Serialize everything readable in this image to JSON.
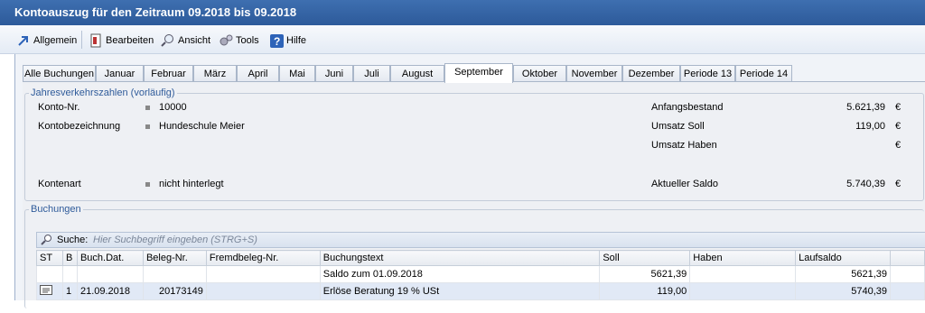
{
  "window": {
    "title": "Kontoauszug für den Zeitraum 09.2018 bis 09.2018"
  },
  "menu": [
    {
      "label": "Allgemein",
      "icon": "arrow-icon"
    },
    {
      "label": "Bearbeiten",
      "icon": "edit-icon"
    },
    {
      "label": "Ansicht",
      "icon": "magnifier-icon"
    },
    {
      "label": "Tools",
      "icon": "gears-icon"
    },
    {
      "label": "Hilfe",
      "icon": "help-icon"
    }
  ],
  "tabs": [
    "Alle Buchungen",
    "Januar",
    "Februar",
    "März",
    "April",
    "Mai",
    "Juni",
    "Juli",
    "August",
    "September",
    "Oktober",
    "November",
    "Dezember",
    "Periode 13",
    "Periode 14"
  ],
  "active_tab": "September",
  "summary": {
    "group_title": "Jahresverkehrszahlen (vorläufig)",
    "konto_label": "Konto-Nr.",
    "konto_value": "10000",
    "bez_label": "Kontobezeichnung",
    "bez_value": "Hundeschule Meier",
    "art_label": "Kontenart",
    "art_value": "nicht hinterlegt",
    "anfang_label": "Anfangsbestand",
    "anfang_value": "5.621,39",
    "soll_label": "Umsatz Soll",
    "soll_value": "119,00",
    "haben_label": "Umsatz Haben",
    "haben_value": "",
    "saldo_label": "Aktueller Saldo",
    "saldo_value": "5.740,39",
    "currency": "€"
  },
  "bookings": {
    "group_title": "Buchungen",
    "search_label": "Suche:",
    "search_placeholder": "Hier Suchbegriff eingeben (STRG+S)",
    "columns": [
      "ST",
      "B",
      "Buch.Dat.",
      "Beleg-Nr.",
      "Fremdbeleg-Nr.",
      "Buchungstext",
      "Soll",
      "Haben",
      "Laufsaldo"
    ],
    "rows": [
      {
        "st": "",
        "b": "",
        "date": "",
        "beleg": "",
        "fremd": "",
        "text": "Saldo zum 01.09.2018",
        "soll": "5621,39",
        "haben": "",
        "lauf": "5621,39"
      },
      {
        "st": "icon",
        "b": "1",
        "date": "21.09.2018",
        "beleg": "20173149",
        "fremd": "",
        "text": "Erlöse Beratung 19 % USt",
        "soll": "119,00",
        "haben": "",
        "lauf": "5740,39"
      }
    ]
  },
  "colors": {
    "title_bg": "#2d5a9a",
    "accent": "#2f5b9a"
  }
}
